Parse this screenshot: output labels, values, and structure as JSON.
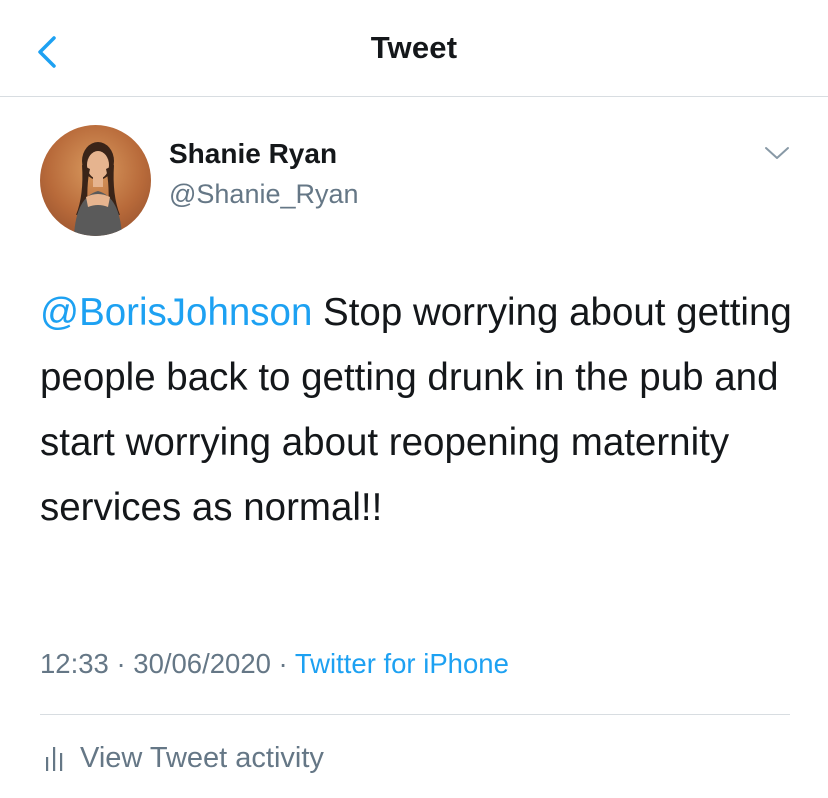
{
  "header": {
    "title": "Tweet"
  },
  "author": {
    "display_name": "Shanie Ryan",
    "handle": "@Shanie_Ryan"
  },
  "tweet": {
    "mention": "@BorisJohnson",
    "body": " Stop worrying about getting people back to getting drunk in the pub and start worrying about reopening maternity services as normal!!"
  },
  "meta": {
    "time": "12:33",
    "separator": " · ",
    "date": "30/06/2020",
    "source": "Twitter for iPhone"
  },
  "activity": {
    "label": "View Tweet activity"
  },
  "icons": {
    "back": "chevron-left-icon",
    "menu": "chevron-down-icon",
    "activity": "bar-chart-icon"
  },
  "colors": {
    "accent": "#1da1f2",
    "text": "#14171a",
    "secondary": "#657786",
    "divider": "#d8dde1"
  }
}
